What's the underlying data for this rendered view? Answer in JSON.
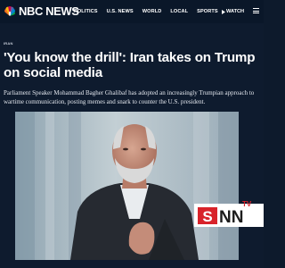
{
  "header": {
    "logo_text": "NBC NEWS",
    "nav": [
      "POLITICS",
      "U.S. NEWS",
      "WORLD",
      "LOCAL",
      "SPORTS"
    ],
    "watch_label": "WATCH"
  },
  "article": {
    "category": "IRAN",
    "headline": "'You know the drill': Iran takes on Trump on social media",
    "dek": "Parliament Speaker Mohammad Bagher Ghalibaf has adopted an increasingly Trumpian approach to wartime communication, posting memes and snark to counter the U.S. president."
  },
  "watermark": {
    "top_text": "TV",
    "brand_text": "SNN"
  },
  "colors": {
    "page_background": "#0e1b2e",
    "header_background": "#0a1729",
    "watermark_red": "#d8232a"
  },
  "icons": {
    "logo": "nbc-peacock-icon",
    "watch": "play-icon",
    "menu": "hamburger-icon"
  }
}
